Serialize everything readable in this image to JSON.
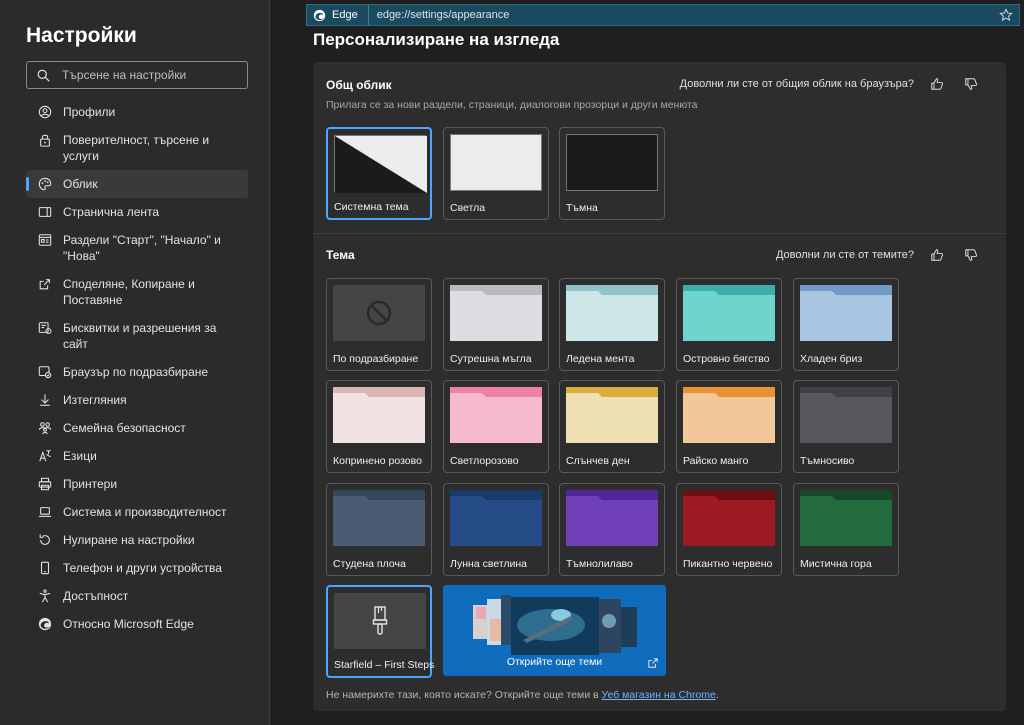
{
  "sidebar": {
    "title": "Настройки",
    "search_placeholder": "Търсене на настройки",
    "items": [
      {
        "label": "Профили",
        "icon": "profile-icon"
      },
      {
        "label": "Поверителност, търсене и услуги",
        "icon": "lock-icon"
      },
      {
        "label": "Облик",
        "icon": "palette-icon",
        "active": true
      },
      {
        "label": "Странична лента",
        "icon": "sidebar-icon"
      },
      {
        "label": "Раздели \"Старт\", \"Начало\" и \"Нова\"",
        "icon": "start-page-icon"
      },
      {
        "label": "Споделяне, Копиране и Поставяне",
        "icon": "share-icon"
      },
      {
        "label": "Бисквитки и разрешения за сайт",
        "icon": "cookie-permissions-icon"
      },
      {
        "label": "Браузър по подразбиране",
        "icon": "default-browser-icon"
      },
      {
        "label": "Изтегляния",
        "icon": "download-icon"
      },
      {
        "label": "Семейна безопасност",
        "icon": "family-icon"
      },
      {
        "label": "Езици",
        "icon": "language-icon"
      },
      {
        "label": "Принтери",
        "icon": "printer-icon"
      },
      {
        "label": "Система и производителност",
        "icon": "laptop-icon"
      },
      {
        "label": "Нулиране на настройки",
        "icon": "reset-icon"
      },
      {
        "label": "Телефон и други устройства",
        "icon": "phone-icon"
      },
      {
        "label": "Достъпност",
        "icon": "accessibility-icon"
      },
      {
        "label": "Относно Microsoft Edge",
        "icon": "edge-logo-icon"
      }
    ]
  },
  "addressbar": {
    "browser_label": "Edge",
    "url": "edge://settings/appearance"
  },
  "page_title": "Персонализиране на изгледа",
  "general": {
    "heading": "Общ облик",
    "feedback": "Доволни ли сте от общия облик на браузъра?",
    "subtitle": "Прилага се за нови раздели, страници, диалогови прозорци и други менюта",
    "modes": [
      {
        "label": "Системна тема",
        "selected": true
      },
      {
        "label": "Светла",
        "selected": false
      },
      {
        "label": "Тъмна",
        "selected": false
      }
    ]
  },
  "theme": {
    "heading": "Тема",
    "feedback": "Доволни ли сте от темите?",
    "items": [
      {
        "label": "По подразбиране",
        "tab": "#454545",
        "body": "#454545",
        "kind": "default"
      },
      {
        "label": "Сутрешна мъгла",
        "tab": "#b9babf",
        "body": "#dcdde1"
      },
      {
        "label": "Ледена мента",
        "tab": "#8fc3c8",
        "body": "#cfe6e8"
      },
      {
        "label": "Островно бягство",
        "tab": "#3aaea9",
        "body": "#6fd4cc"
      },
      {
        "label": "Хладен бриз",
        "tab": "#6f9cc6",
        "body": "#a8c5e2"
      },
      {
        "label": "Копринено розово",
        "tab": "#d9b6b3",
        "body": "#f2e3e2"
      },
      {
        "label": "Светлорозово",
        "tab": "#ee7fa6",
        "body": "#f5b9d0"
      },
      {
        "label": "Слънчев ден",
        "tab": "#d8ad3a",
        "body": "#eee0b3"
      },
      {
        "label": "Райско манго",
        "tab": "#e99232",
        "body": "#f2c79a"
      },
      {
        "label": "Тъмносиво",
        "tab": "#3f4146",
        "body": "#55575d"
      },
      {
        "label": "Студена плоча",
        "tab": "#34465e",
        "body": "#4a5a70"
      },
      {
        "label": "Лунна светлина",
        "tab": "#1a3a6a",
        "body": "#254c86"
      },
      {
        "label": "Тъмнолилаво",
        "tab": "#4f2796",
        "body": "#7040b8"
      },
      {
        "label": "Пикантно червено",
        "tab": "#6d0e14",
        "body": "#9e1a22"
      },
      {
        "label": "Мистична гора",
        "tab": "#17462a",
        "body": "#236b3c"
      },
      {
        "label": "Starfield – First Steps",
        "kind": "brush",
        "selected": true
      }
    ],
    "more_themes": "Открийте още теми",
    "footer_text": "Не намерихте тази, която искате? Открийте още теми в",
    "footer_link": "Уеб магазин на Chrome",
    "footer_end": "."
  },
  "colors": {
    "accent": "#4ea5ff",
    "card": "#2d2d2d",
    "sidebar": "#2b2b2b",
    "store_blue": "#0f6cbd"
  }
}
